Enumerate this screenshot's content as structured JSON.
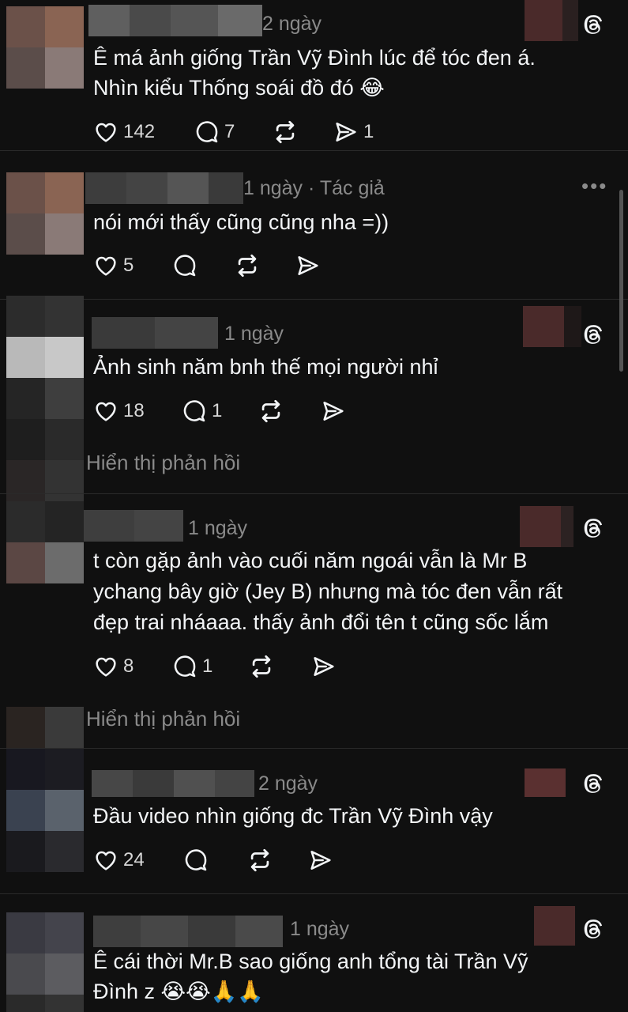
{
  "comments": [
    {
      "time": "2 ngày",
      "text_lines": [
        "Ê má ảnh giống Trần Vỹ Đình lúc để tóc đen á.",
        "Nhìn kiểu Thống soái đồ đó 😂"
      ],
      "likes": "142",
      "replies": "7",
      "shares": "1"
    },
    {
      "time": "1 ngày",
      "author_tag": "· Tác giả",
      "text_lines": [
        "nói mới thấy cũng cũng nha =))"
      ],
      "likes": "5"
    },
    {
      "time": "1 ngày",
      "text_lines": [
        "Ảnh sinh năm bnh thế mọi người nhỉ"
      ],
      "likes": "18",
      "replies": "1",
      "show_replies": "Hiển thị phản hồi"
    },
    {
      "time": "1 ngày",
      "text_lines": [
        "t còn gặp ảnh vào cuối năm ngoái vẫn là Mr B",
        "ychang bây giờ (Jey B) nhưng mà tóc đen vẫn rất",
        "đẹp trai nháaaa. thấy ảnh đổi tên t cũng sốc lắm"
      ],
      "likes": "8",
      "replies": "1",
      "show_replies": "Hiển thị phản hồi"
    },
    {
      "time": "2 ngày",
      "text_lines": [
        "Đầu video nhìn giống đc Trần Vỹ Đình vậy"
      ],
      "likes": "24"
    },
    {
      "time": "1 ngày",
      "text_lines": [
        "Ê cái thời Mr.B sao giống anh tổng tài Trần Vỹ",
        "Đình z 😭😭🙏🙏"
      ]
    }
  ],
  "icons": {
    "like": "heart-icon",
    "reply": "comment-bubble-icon",
    "repost": "repost-icon",
    "share": "send-icon",
    "threads": "threads-logo-icon",
    "more": "more-icon"
  },
  "colors": {
    "background": "#101010",
    "text": "#f3f5f7",
    "secondary": "#8a8a8a"
  }
}
